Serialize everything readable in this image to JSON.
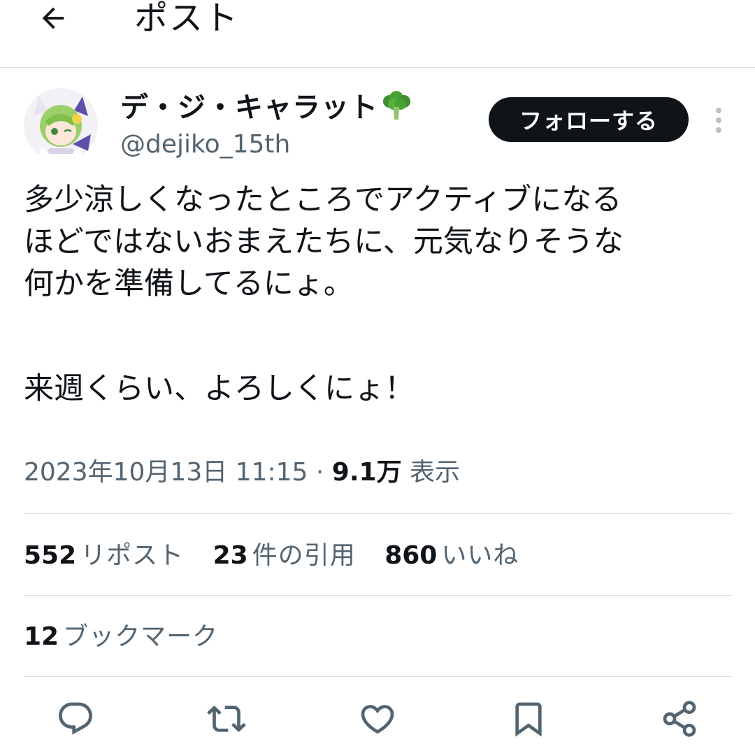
{
  "header": {
    "title": "ポスト",
    "back_icon": "arrow-left-icon"
  },
  "author": {
    "display_name": "デ・ジ・キャラット",
    "name_emoji_icon": "broccoli-icon",
    "handle": "@dejiko_15th",
    "follow_label": "フォローする",
    "more_icon": "more-vertical-icon"
  },
  "post": {
    "lines": [
      "多少涼しくなったところでアクティブになる",
      "ほどではないおまえたちに、元気なりそうな",
      "何かを準備してるにょ。",
      "来週くらい、よろしくにょ！"
    ],
    "timestamp": "2023年10月13日 11:15",
    "separator": "·",
    "views_count": "9.1万",
    "views_label": "表示"
  },
  "stats": {
    "reposts_count": "552",
    "reposts_label": "リポスト",
    "quotes_count": "23",
    "quotes_label": "件の引用",
    "likes_count": "860",
    "likes_label": "いいね",
    "bookmarks_count": "12",
    "bookmarks_label": "ブックマーク"
  },
  "actions": [
    "reply-icon",
    "repost-icon",
    "like-icon",
    "bookmark-icon",
    "share-icon"
  ],
  "colors": {
    "text": "#0f1419",
    "secondary_text": "#536471",
    "divider": "#dcdfe3",
    "follow_button_bg": "#0f1419",
    "follow_button_text": "#ffffff"
  }
}
